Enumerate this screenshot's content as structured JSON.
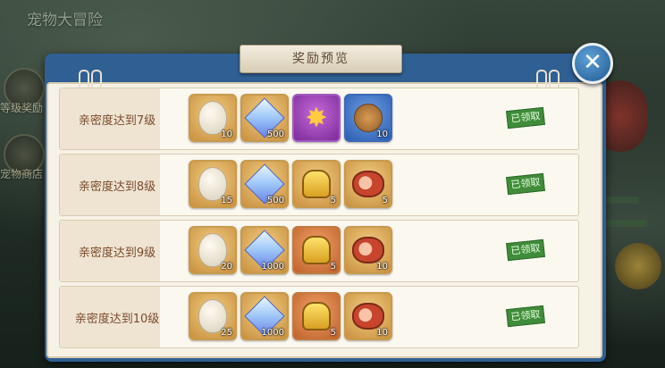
{
  "game": {
    "title": "宠物大冒险",
    "side_buttons": [
      {
        "label": "等级奖励"
      },
      {
        "label": "宠物商店"
      }
    ]
  },
  "dialog": {
    "title": "奖励预览",
    "close_icon": "close-icon"
  },
  "rows": [
    {
      "label": "亲密度达到7级",
      "status": "已领取",
      "items": [
        {
          "icon": "egg-icon",
          "qty": "10",
          "frame": "gold"
        },
        {
          "icon": "diamond-icon",
          "qty": "500",
          "frame": "gold"
        },
        {
          "icon": "claw-icon",
          "qty": "",
          "frame": "purple"
        },
        {
          "icon": "cookie-icon",
          "qty": "10",
          "frame": "blue"
        }
      ]
    },
    {
      "label": "亲密度达到8级",
      "status": "已领取",
      "items": [
        {
          "icon": "egg-icon",
          "qty": "15",
          "frame": "gold"
        },
        {
          "icon": "diamond-icon",
          "qty": "500",
          "frame": "gold"
        },
        {
          "icon": "helmet-icon",
          "qty": "5",
          "frame": "gold"
        },
        {
          "icon": "ham-icon",
          "qty": "5",
          "frame": "gold"
        }
      ]
    },
    {
      "label": "亲密度达到9级",
      "status": "已领取",
      "items": [
        {
          "icon": "egg-icon",
          "qty": "20",
          "frame": "gold"
        },
        {
          "icon": "diamond-icon",
          "qty": "1000",
          "frame": "gold"
        },
        {
          "icon": "helmet-icon",
          "qty": "5",
          "frame": "orange"
        },
        {
          "icon": "ham-icon",
          "qty": "10",
          "frame": "gold"
        }
      ]
    },
    {
      "label": "亲密度达到10级",
      "status": "已领取",
      "items": [
        {
          "icon": "egg-icon",
          "qty": "25",
          "frame": "gold"
        },
        {
          "icon": "diamond-icon",
          "qty": "1000",
          "frame": "gold"
        },
        {
          "icon": "helmet-icon",
          "qty": "5",
          "frame": "orange"
        },
        {
          "icon": "ham-icon",
          "qty": "10",
          "frame": "gold"
        }
      ]
    }
  ]
}
